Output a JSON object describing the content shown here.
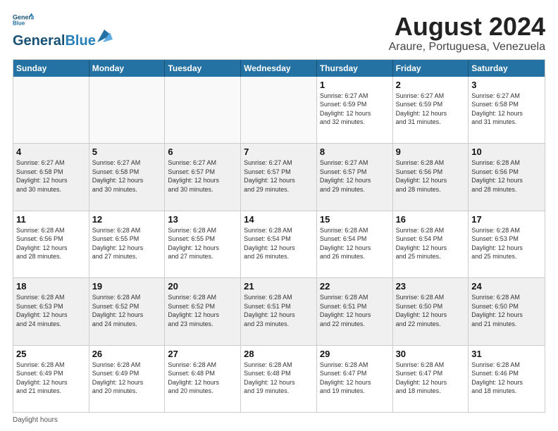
{
  "header": {
    "logo_line1": "General",
    "logo_line2": "Blue",
    "month_title": "August 2024",
    "location": "Araure, Portuguesa, Venezuela"
  },
  "days_of_week": [
    "Sunday",
    "Monday",
    "Tuesday",
    "Wednesday",
    "Thursday",
    "Friday",
    "Saturday"
  ],
  "footer": {
    "daylight_label": "Daylight hours"
  },
  "weeks": [
    [
      {
        "day": "",
        "empty": true
      },
      {
        "day": "",
        "empty": true
      },
      {
        "day": "",
        "empty": true
      },
      {
        "day": "",
        "empty": true
      },
      {
        "day": "1",
        "info": "Sunrise: 6:27 AM\nSunset: 6:59 PM\nDaylight: 12 hours\nand 32 minutes."
      },
      {
        "day": "2",
        "info": "Sunrise: 6:27 AM\nSunset: 6:59 PM\nDaylight: 12 hours\nand 31 minutes."
      },
      {
        "day": "3",
        "info": "Sunrise: 6:27 AM\nSunset: 6:58 PM\nDaylight: 12 hours\nand 31 minutes."
      }
    ],
    [
      {
        "day": "4",
        "info": "Sunrise: 6:27 AM\nSunset: 6:58 PM\nDaylight: 12 hours\nand 30 minutes.",
        "shaded": true
      },
      {
        "day": "5",
        "info": "Sunrise: 6:27 AM\nSunset: 6:58 PM\nDaylight: 12 hours\nand 30 minutes.",
        "shaded": true
      },
      {
        "day": "6",
        "info": "Sunrise: 6:27 AM\nSunset: 6:57 PM\nDaylight: 12 hours\nand 30 minutes.",
        "shaded": true
      },
      {
        "day": "7",
        "info": "Sunrise: 6:27 AM\nSunset: 6:57 PM\nDaylight: 12 hours\nand 29 minutes.",
        "shaded": true
      },
      {
        "day": "8",
        "info": "Sunrise: 6:27 AM\nSunset: 6:57 PM\nDaylight: 12 hours\nand 29 minutes.",
        "shaded": true
      },
      {
        "day": "9",
        "info": "Sunrise: 6:28 AM\nSunset: 6:56 PM\nDaylight: 12 hours\nand 28 minutes.",
        "shaded": true
      },
      {
        "day": "10",
        "info": "Sunrise: 6:28 AM\nSunset: 6:56 PM\nDaylight: 12 hours\nand 28 minutes.",
        "shaded": true
      }
    ],
    [
      {
        "day": "11",
        "info": "Sunrise: 6:28 AM\nSunset: 6:56 PM\nDaylight: 12 hours\nand 28 minutes."
      },
      {
        "day": "12",
        "info": "Sunrise: 6:28 AM\nSunset: 6:55 PM\nDaylight: 12 hours\nand 27 minutes."
      },
      {
        "day": "13",
        "info": "Sunrise: 6:28 AM\nSunset: 6:55 PM\nDaylight: 12 hours\nand 27 minutes."
      },
      {
        "day": "14",
        "info": "Sunrise: 6:28 AM\nSunset: 6:54 PM\nDaylight: 12 hours\nand 26 minutes."
      },
      {
        "day": "15",
        "info": "Sunrise: 6:28 AM\nSunset: 6:54 PM\nDaylight: 12 hours\nand 26 minutes."
      },
      {
        "day": "16",
        "info": "Sunrise: 6:28 AM\nSunset: 6:54 PM\nDaylight: 12 hours\nand 25 minutes."
      },
      {
        "day": "17",
        "info": "Sunrise: 6:28 AM\nSunset: 6:53 PM\nDaylight: 12 hours\nand 25 minutes."
      }
    ],
    [
      {
        "day": "18",
        "info": "Sunrise: 6:28 AM\nSunset: 6:53 PM\nDaylight: 12 hours\nand 24 minutes.",
        "shaded": true
      },
      {
        "day": "19",
        "info": "Sunrise: 6:28 AM\nSunset: 6:52 PM\nDaylight: 12 hours\nand 24 minutes.",
        "shaded": true
      },
      {
        "day": "20",
        "info": "Sunrise: 6:28 AM\nSunset: 6:52 PM\nDaylight: 12 hours\nand 23 minutes.",
        "shaded": true
      },
      {
        "day": "21",
        "info": "Sunrise: 6:28 AM\nSunset: 6:51 PM\nDaylight: 12 hours\nand 23 minutes.",
        "shaded": true
      },
      {
        "day": "22",
        "info": "Sunrise: 6:28 AM\nSunset: 6:51 PM\nDaylight: 12 hours\nand 22 minutes.",
        "shaded": true
      },
      {
        "day": "23",
        "info": "Sunrise: 6:28 AM\nSunset: 6:50 PM\nDaylight: 12 hours\nand 22 minutes.",
        "shaded": true
      },
      {
        "day": "24",
        "info": "Sunrise: 6:28 AM\nSunset: 6:50 PM\nDaylight: 12 hours\nand 21 minutes.",
        "shaded": true
      }
    ],
    [
      {
        "day": "25",
        "info": "Sunrise: 6:28 AM\nSunset: 6:49 PM\nDaylight: 12 hours\nand 21 minutes."
      },
      {
        "day": "26",
        "info": "Sunrise: 6:28 AM\nSunset: 6:49 PM\nDaylight: 12 hours\nand 20 minutes."
      },
      {
        "day": "27",
        "info": "Sunrise: 6:28 AM\nSunset: 6:48 PM\nDaylight: 12 hours\nand 20 minutes."
      },
      {
        "day": "28",
        "info": "Sunrise: 6:28 AM\nSunset: 6:48 PM\nDaylight: 12 hours\nand 19 minutes."
      },
      {
        "day": "29",
        "info": "Sunrise: 6:28 AM\nSunset: 6:47 PM\nDaylight: 12 hours\nand 19 minutes."
      },
      {
        "day": "30",
        "info": "Sunrise: 6:28 AM\nSunset: 6:47 PM\nDaylight: 12 hours\nand 18 minutes."
      },
      {
        "day": "31",
        "info": "Sunrise: 6:28 AM\nSunset: 6:46 PM\nDaylight: 12 hours\nand 18 minutes."
      }
    ]
  ]
}
